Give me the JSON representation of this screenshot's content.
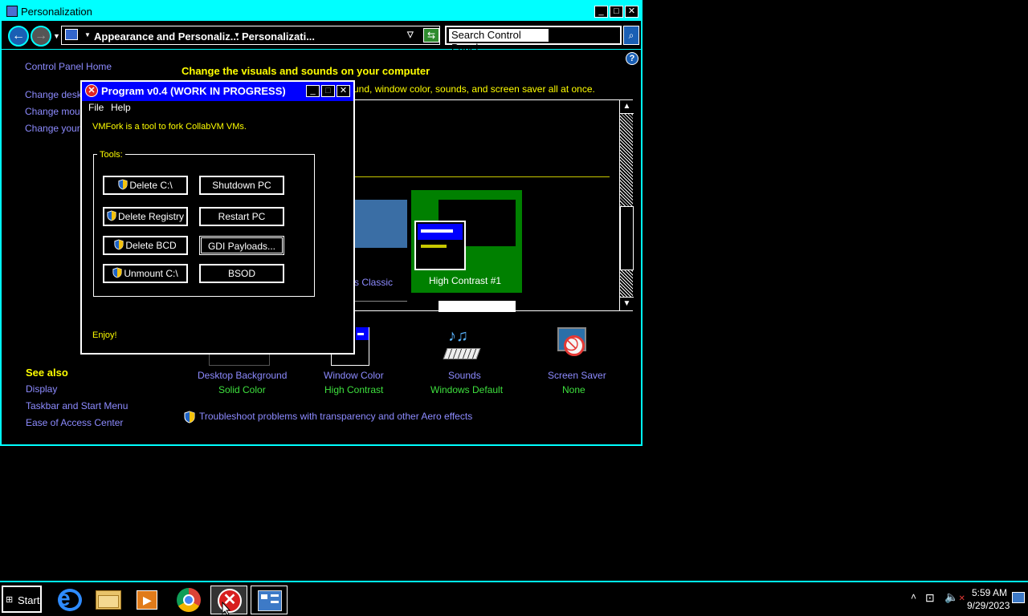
{
  "window": {
    "title": "Personalization",
    "breadcrumb_1": "Appearance and Personaliz...",
    "breadcrumb_2": "Personalizati...",
    "search_placeholder": "Search Control Panel"
  },
  "sidebar": {
    "home": "Control Panel Home",
    "links": [
      "Change deskto",
      "Change mouse",
      "Change your a"
    ],
    "see_also_title": "See also",
    "see_also": [
      "Display",
      "Taskbar and Start Menu",
      "Ease of Access Center"
    ]
  },
  "main": {
    "heading": "Change the visuals and sounds on your computer",
    "subheading": "und, window color, sounds, and screen saver all at once.",
    "themes": [
      {
        "label": "s Classic"
      },
      {
        "label": "High Contrast #1",
        "selected": true
      }
    ],
    "settings": [
      {
        "label": "Desktop Background",
        "value": "Solid Color"
      },
      {
        "label": "Window Color",
        "value": "High Contrast"
      },
      {
        "label": "Sounds",
        "value": "Windows Default"
      },
      {
        "label": "Screen Saver",
        "value": "None"
      }
    ],
    "troubleshoot": "Troubleshoot problems with transparency and other Aero effects"
  },
  "dialog": {
    "title": "Program v0.4 (WORK IN PROGRESS)",
    "menu": [
      "File",
      "Help"
    ],
    "description": "VMFork is a tool to fork CollabVM VMs.",
    "group_label": "Tools:",
    "buttons": {
      "delete_c": "Delete C:\\",
      "shutdown": "Shutdown PC",
      "delete_registry": "Delete Registry",
      "restart": "Restart PC",
      "delete_bcd": "Delete BCD",
      "gdi": "GDI Payloads...",
      "unmount_c": "Unmount C:\\",
      "bsod": "BSOD"
    },
    "footer": "Enjoy!"
  },
  "taskbar": {
    "start": "Start",
    "time": "5:59 AM",
    "date": "9/29/2023"
  },
  "colors": {
    "hc_border": "#00ffff",
    "dialog_title": "#0000ff",
    "link": "#8d8bff",
    "value": "#3ee03e",
    "heading": "#ffff00",
    "theme_selected": "#008000"
  }
}
